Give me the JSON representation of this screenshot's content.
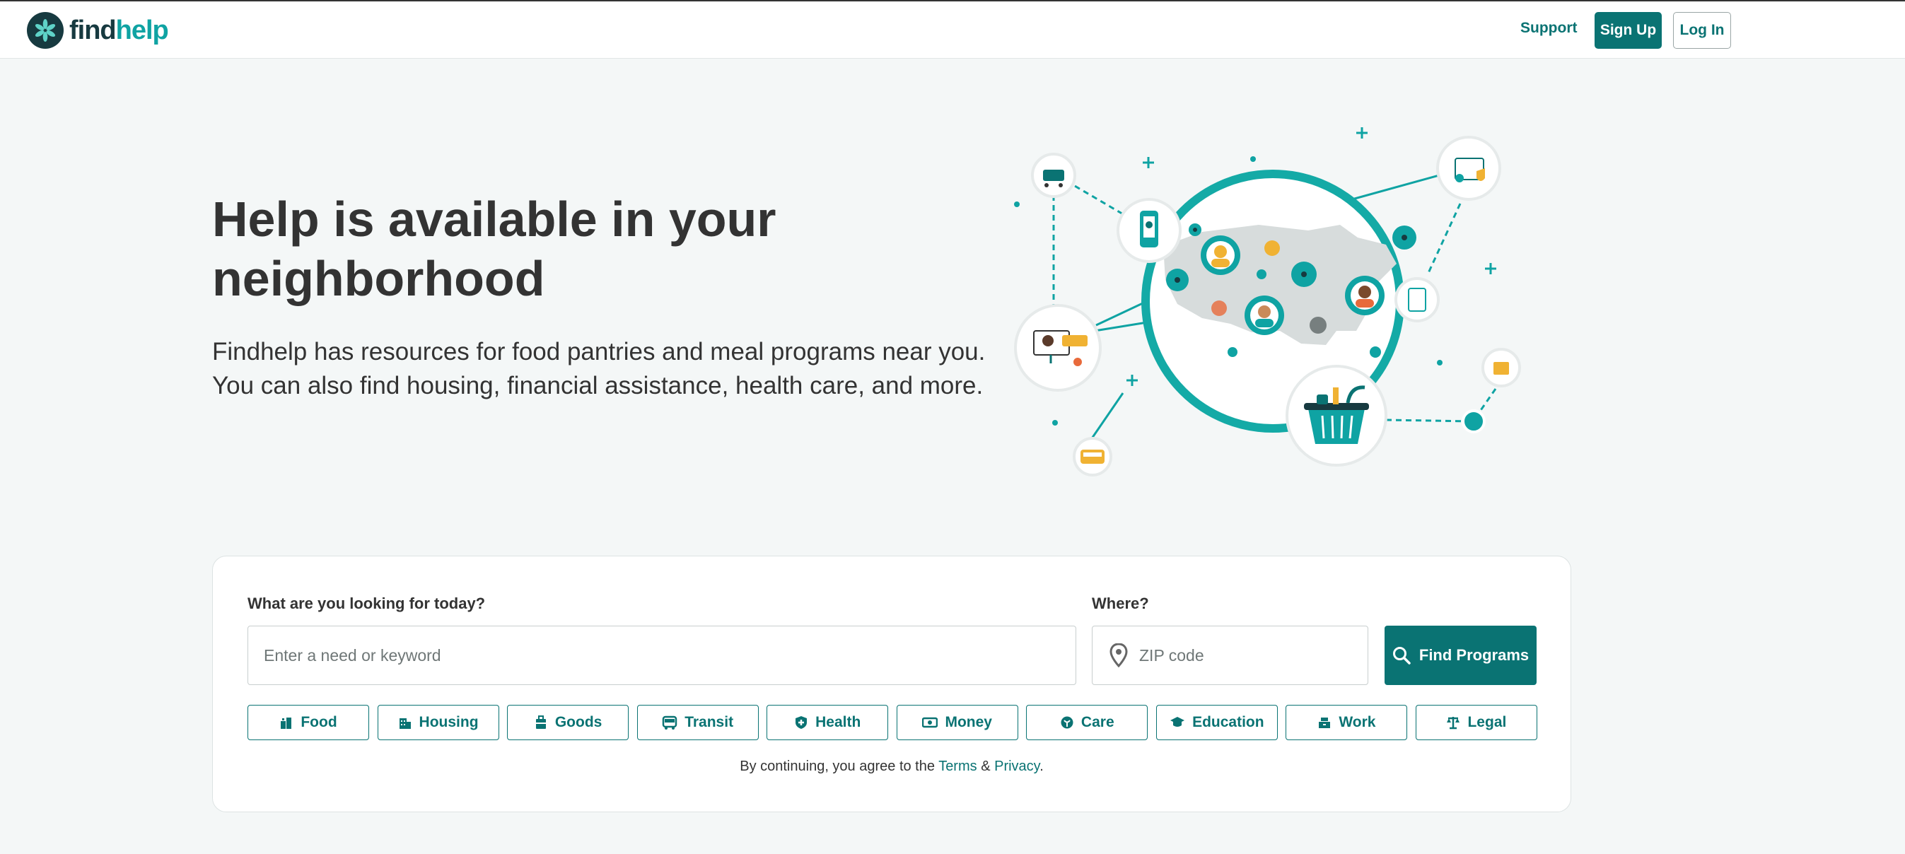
{
  "header": {
    "logo_find": "find",
    "logo_help": "help",
    "support": "Support",
    "sign_up": "Sign Up",
    "log_in": "Log In"
  },
  "hero": {
    "title": "Help is available in your neighborhood",
    "subtitle_line1": "Findhelp has resources for food pantries and meal programs near you.",
    "subtitle_line2": "You can also find housing, financial assistance, health care, and more."
  },
  "search": {
    "what_label": "What are you looking for today?",
    "what_placeholder": "Enter a need or keyword",
    "where_label": "Where?",
    "zip_placeholder": "ZIP code",
    "submit": "Find Programs",
    "categories": [
      {
        "label": "Food",
        "icon": "food-icon"
      },
      {
        "label": "Housing",
        "icon": "housing-icon"
      },
      {
        "label": "Goods",
        "icon": "goods-icon"
      },
      {
        "label": "Transit",
        "icon": "transit-icon"
      },
      {
        "label": "Health",
        "icon": "health-icon"
      },
      {
        "label": "Money",
        "icon": "money-icon"
      },
      {
        "label": "Care",
        "icon": "care-icon"
      },
      {
        "label": "Education",
        "icon": "education-icon"
      },
      {
        "label": "Work",
        "icon": "work-icon"
      },
      {
        "label": "Legal",
        "icon": "legal-icon"
      }
    ],
    "terms_prefix": "By continuing, you agree to the",
    "terms_link": "Terms",
    "terms_amp": "&",
    "privacy_link": "Privacy",
    "terms_suffix": "."
  },
  "colors": {
    "brand": "#0a7373",
    "brand_light": "#0fa3a3",
    "logo_dark": "#173a40",
    "background": "#f4f7f7"
  }
}
